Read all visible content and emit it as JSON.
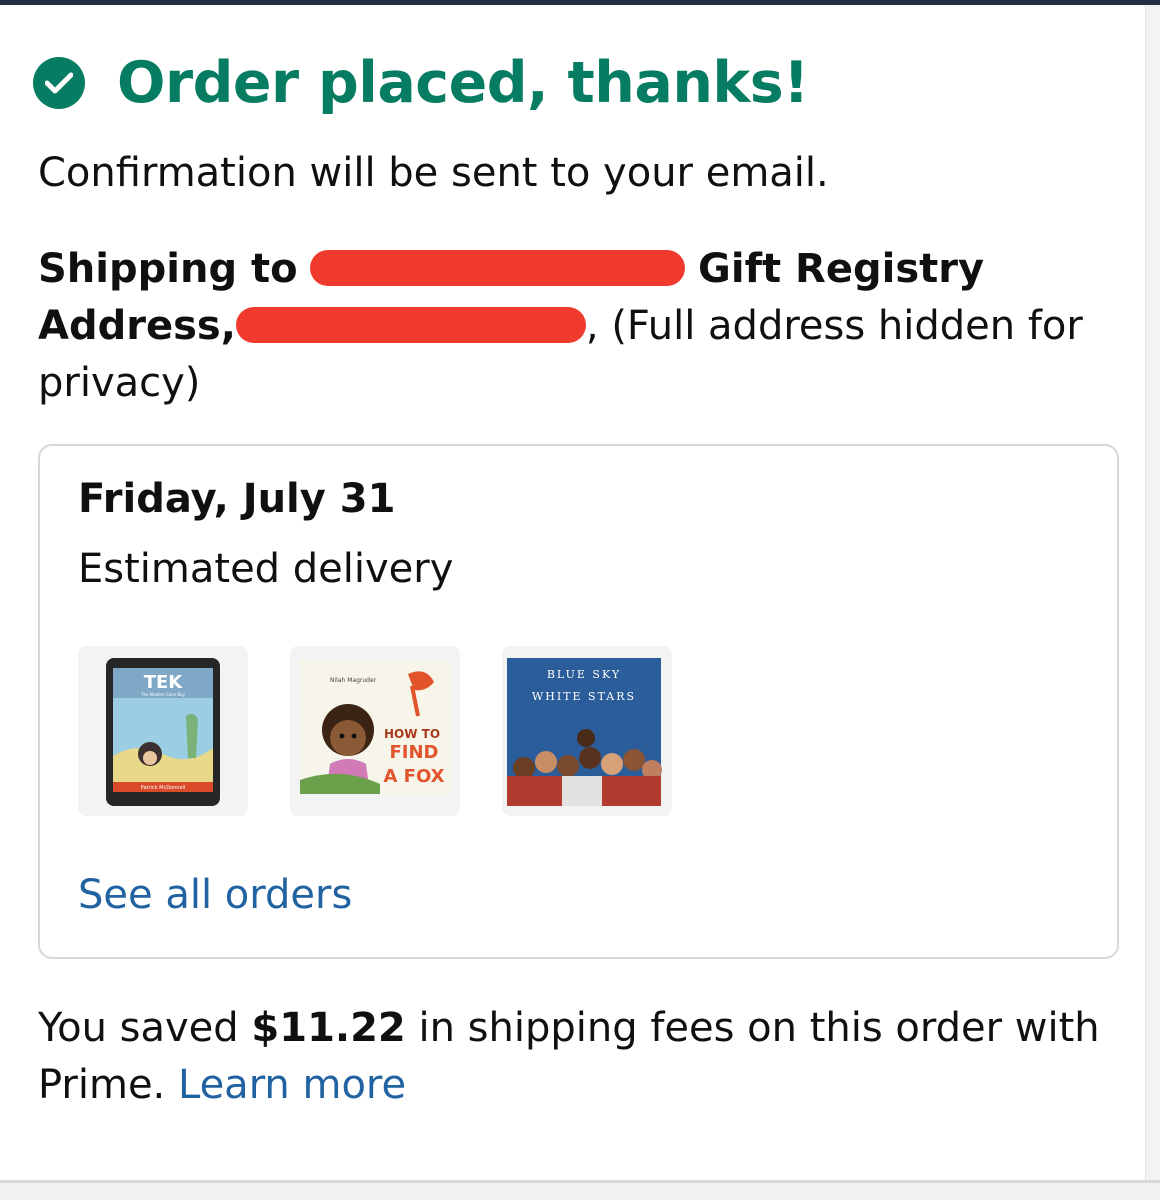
{
  "header": {
    "check_icon": "check-circle-icon",
    "title": "Order placed, thanks!"
  },
  "confirmation": "Confirmation will be sent to your email.",
  "shipping": {
    "prefix": "Shipping to",
    "registry_suffix": "Gift Registry",
    "address_label": "Address,",
    "hidden_note": ", (Full address hidden for privacy)"
  },
  "delivery": {
    "date": "Friday, July 31",
    "label": "Estimated delivery",
    "items": [
      {
        "title": "TEK",
        "subtitle": "The Modern Cave Boy",
        "author": "Patrick McDonnell"
      },
      {
        "author": "Nilah Magruder",
        "title_line1": "HOW TO",
        "title_line2": "FIND",
        "title_line3": "A FOX"
      },
      {
        "title_line1": "BLUE SKY",
        "title_line2": "WHITE STARS"
      }
    ],
    "see_all": "See all orders"
  },
  "savings": {
    "prefix": "You saved",
    "amount": "$11.22",
    "suffix": "in shipping fees on this order with Prime.",
    "link": "Learn more"
  },
  "colors": {
    "success_green": "#067d62",
    "link_blue": "#2162a1",
    "redaction_red": "#f03a2e"
  }
}
